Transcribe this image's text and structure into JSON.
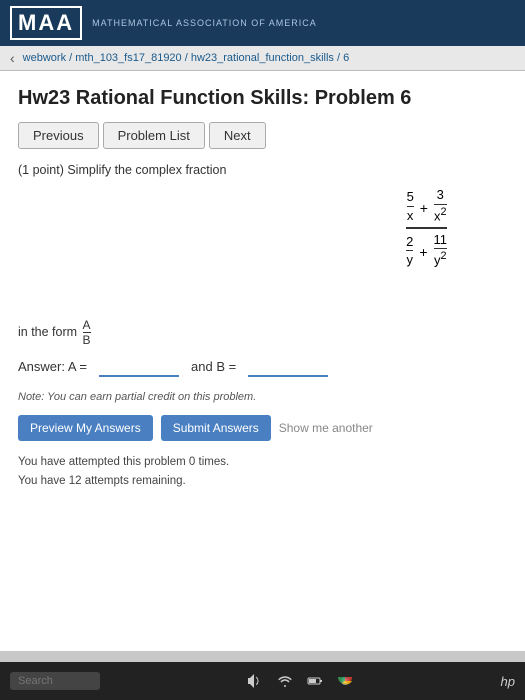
{
  "maa": {
    "logo": "MAA",
    "subtitle": "MATHEMATICAL ASSOCIATION OF AMERICA"
  },
  "url": {
    "back_arrow": "‹",
    "breadcrumb": "webwork / mth_103_fs17_81920 / hw23_rational_function_skills / 6"
  },
  "page": {
    "title": "Hw23 Rational Function Skills: Problem 6",
    "points": "(1 point)",
    "problem_text": "Simplify the complex fraction",
    "in_the_form_label": "in the form",
    "fraction_form_num": "A",
    "fraction_form_den": "B",
    "answer_label": "Answer: A =",
    "and_label": "and B =",
    "note": "Note: You can earn partial credit on this problem.",
    "attempts_line1": "You have attempted this problem 0 times.",
    "attempts_line2": "You have 12 attempts remaining."
  },
  "navigation": {
    "previous_label": "Previous",
    "problem_list_label": "Problem List",
    "next_label": "Next"
  },
  "buttons": {
    "preview_label": "Preview My Answers",
    "submit_label": "Submit Answers",
    "show_label": "Show me another"
  },
  "complex_fraction": {
    "numerator": {
      "left_num": "5",
      "left_den": "x",
      "plus": "+",
      "right_num": "3",
      "right_den": "x²"
    },
    "denominator": {
      "left_num": "2",
      "left_den": "y",
      "plus": "+",
      "right_num": "11",
      "right_den": "y²"
    }
  },
  "taskbar": {
    "search_placeholder": "Search",
    "hp_label": "hp"
  }
}
